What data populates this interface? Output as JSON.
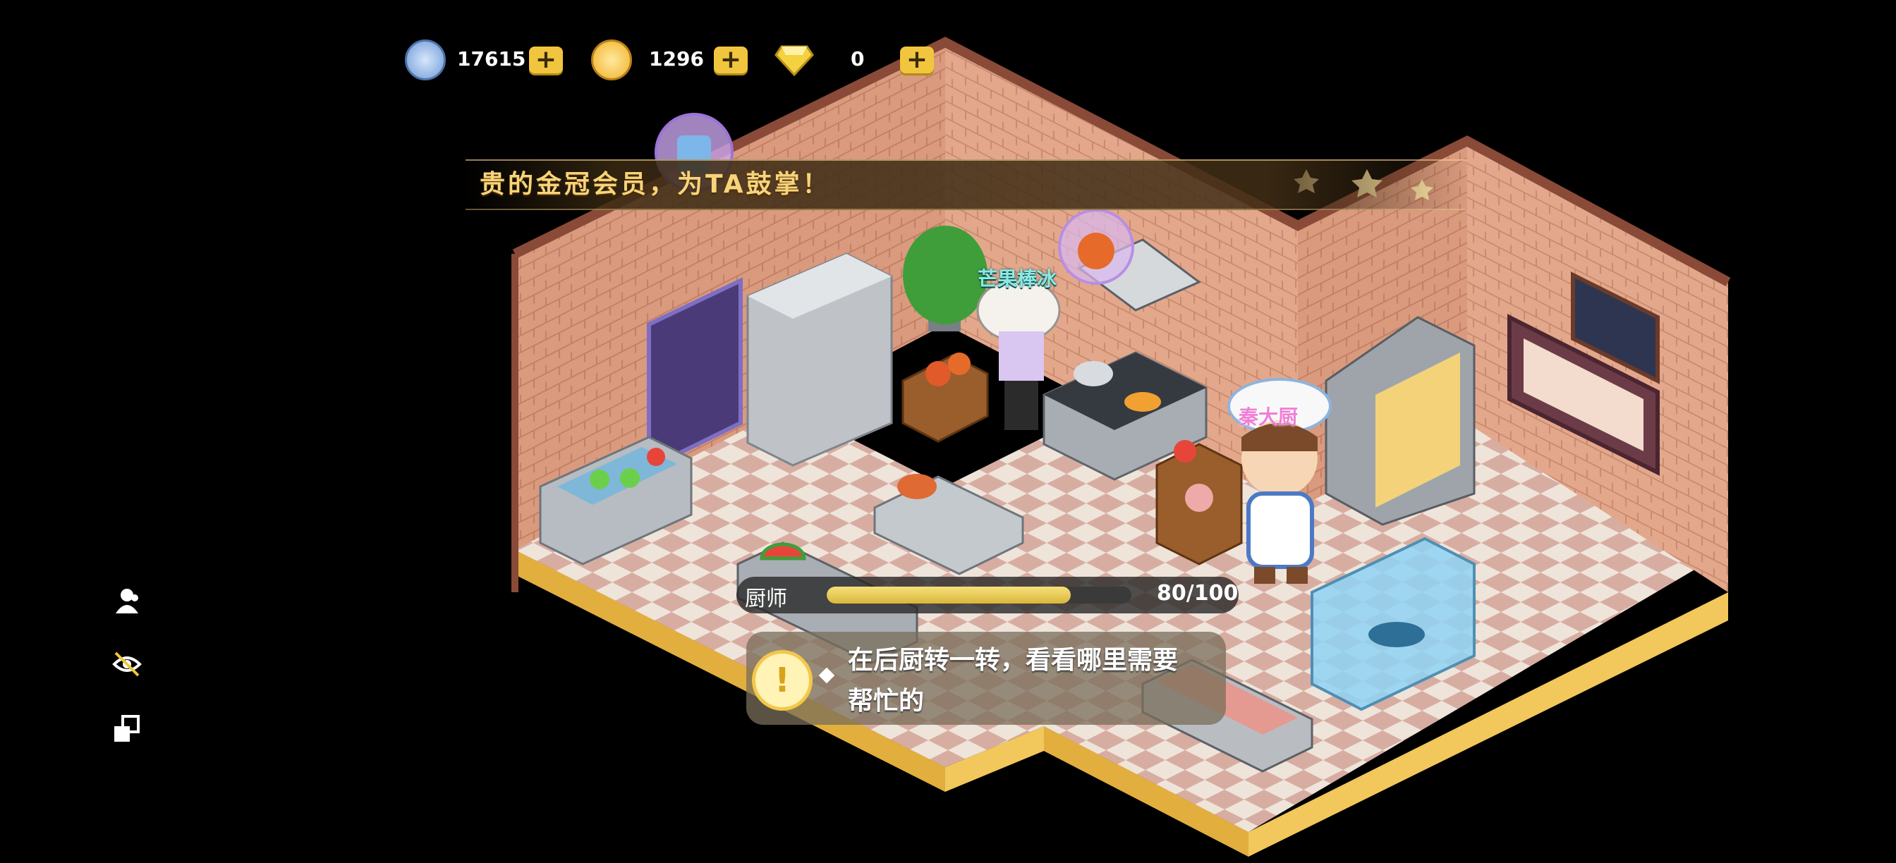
{
  "currencies": [
    {
      "name": "silver-coin",
      "value": "17615",
      "color": "#6f9bd6"
    },
    {
      "name": "gold-coin",
      "value": "1296",
      "color": "#f0b226"
    },
    {
      "name": "diamond",
      "value": "0",
      "color": "#f4d23f"
    }
  ],
  "plus_label": "+",
  "banner": {
    "text": "贵的金冠会员，为TA鼓掌！"
  },
  "npc": {
    "name": "芒果棒冰"
  },
  "chef": {
    "name": "秦大厨"
  },
  "progress": {
    "label": "厨师",
    "value_text": "80/100",
    "fraction": 0.8
  },
  "task": {
    "icon": "!",
    "text": "在后厨转一转，看看哪里需要帮忙的"
  },
  "sidebar": [
    "friends-icon",
    "hide-ui-icon",
    "share-icon"
  ],
  "colors": {
    "accent": "#f1c63e",
    "wall": "#d89a7d",
    "floor_light": "#efe2d8",
    "floor_dark": "#d6b0a4",
    "stage": "#f1c75c"
  }
}
